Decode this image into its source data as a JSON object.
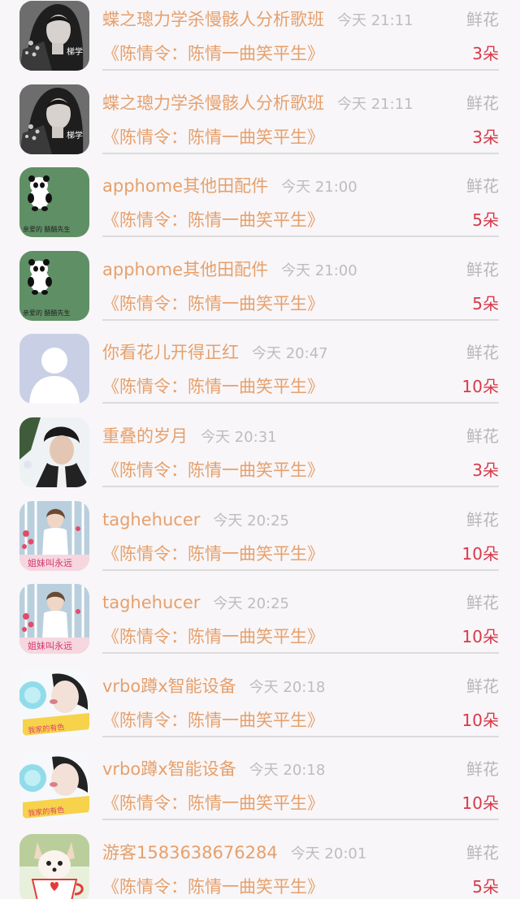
{
  "gift_list": [
    {
      "avatar": "woman-portrait-avatar",
      "username": "蝶之璁力学杀慢骸人分析歌班",
      "time": "今天 21:11",
      "gift_type": "鲜花",
      "song": "《陈情令：陈情一曲笑平生》",
      "count": "3朵"
    },
    {
      "avatar": "woman-portrait-avatar",
      "username": "蝶之璁力学杀慢骸人分析歌班",
      "time": "今天 21:11",
      "gift_type": "鲜花",
      "song": "《陈情令：陈情一曲笑平生》",
      "count": "3朵"
    },
    {
      "avatar": "panda-avatar",
      "username": "apphome其他田配件",
      "time": "今天 21:00",
      "gift_type": "鲜花",
      "song": "《陈情令：陈情一曲笑平生》",
      "count": "5朵"
    },
    {
      "avatar": "panda-avatar",
      "username": "apphome其他田配件",
      "time": "今天 21:00",
      "gift_type": "鲜花",
      "song": "《陈情令：陈情一曲笑平生》",
      "count": "5朵"
    },
    {
      "avatar": "default-user-avatar",
      "username": "你看花儿开得正红",
      "time": "今天 20:47",
      "gift_type": "鲜花",
      "song": "《陈情令：陈情一曲笑平生》",
      "count": "10朵"
    },
    {
      "avatar": "man-portrait-avatar",
      "username": "重叠的岁月",
      "time": "今天 20:31",
      "gift_type": "鲜花",
      "song": "《陈情令：陈情一曲笑平生》",
      "count": "3朵"
    },
    {
      "avatar": "girl-photo-avatar",
      "username": "taghehucer",
      "time": "今天 20:25",
      "gift_type": "鲜花",
      "song": "《陈情令：陈情一曲笑平生》",
      "count": "10朵"
    },
    {
      "avatar": "girl-photo-avatar",
      "username": "taghehucer",
      "time": "今天 20:25",
      "gift_type": "鲜花",
      "song": "《陈情令：陈情一曲笑平生》",
      "count": "10朵"
    },
    {
      "avatar": "woman-blowing-bubble-avatar",
      "username": "vrbo蹲x智能设备",
      "time": "今天 20:18",
      "gift_type": "鲜花",
      "song": "《陈情令：陈情一曲笑平生》",
      "count": "10朵"
    },
    {
      "avatar": "woman-blowing-bubble-avatar",
      "username": "vrbo蹲x智能设备",
      "time": "今天 20:18",
      "gift_type": "鲜花",
      "song": "《陈情令：陈情一曲笑平生》",
      "count": "10朵"
    },
    {
      "avatar": "puppy-in-cup-avatar",
      "username": "游客1583638676284",
      "time": "今天 20:01",
      "gift_type": "鲜花",
      "song": "《陈情令：陈情一曲笑平生》",
      "count": "5朵"
    }
  ],
  "avatar_text": {
    "woman-portrait-avatar": "梯学",
    "panda-avatar": "亲爱的  醋醋先生",
    "girl-photo-avatar": "姐妹叫永远",
    "woman-blowing-bubble-avatar": "我家的有色"
  },
  "colors": {
    "username": "#e6a06c",
    "song": "#e6a06c",
    "time": "#bdbdbd",
    "gift_type": "#b7b7b7",
    "count": "#d9384a",
    "background": "#f8f6f8"
  }
}
